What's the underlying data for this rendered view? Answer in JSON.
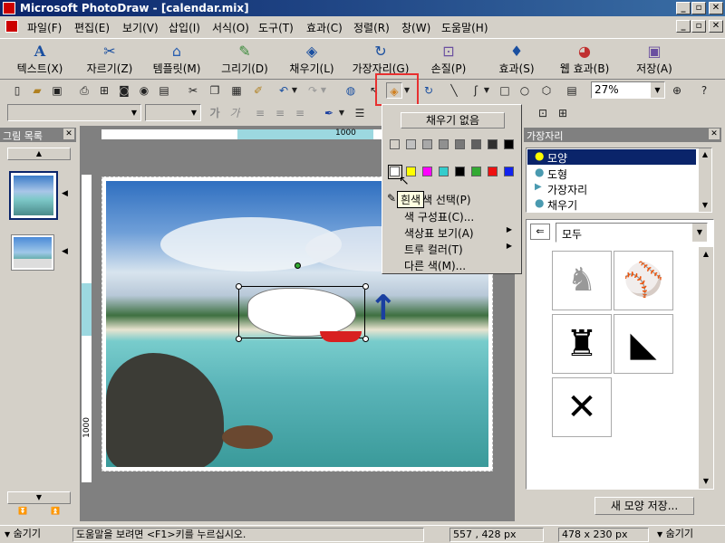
{
  "window": {
    "title": "Microsoft PhotoDraw - [calendar.mix]"
  },
  "menu": [
    "파일(F)",
    "편집(E)",
    "보기(V)",
    "삽입(I)",
    "서식(O)",
    "도구(T)",
    "효과(C)",
    "정렬(R)",
    "창(W)",
    "도움말(H)"
  ],
  "big_toolbar": {
    "text": "텍스트(X)",
    "cut": "자르기(Z)",
    "template": "템플릿(M)",
    "draw": "그리기(D)",
    "fill": "채우기(L)",
    "edge": "가장자리(G)",
    "touchup": "손질(P)",
    "effects": "효과(S)",
    "web_effects": "웹 효과(B)",
    "save": "저장(A)"
  },
  "std_toolbar": {
    "zoom": "27%",
    "help": "?"
  },
  "format_toolbar": {
    "bold": "가",
    "italic": "가"
  },
  "left_panel": {
    "title": "그림 목록"
  },
  "ruler": {
    "top_mark": "1000",
    "left_mark": "1000"
  },
  "fill_dropdown": {
    "no_fill": "채우기 없음",
    "tooltip": "흰색",
    "row1": [
      "#d4d0c8",
      "#c0c0c0",
      "#a8a8a8",
      "#909090",
      "#787878",
      "#606060",
      "#303030",
      "#000000"
    ],
    "row2": [
      "#ffffff",
      "#ffff00",
      "#ff00ff",
      "#33cccc",
      "#000000",
      "#33aa33",
      "#ee1111",
      "#1122ee"
    ],
    "items": [
      "색 선택(P)",
      "색 구성표(C)...",
      "색상표 보기(A)",
      "트루 컬러(T)",
      "다른 색(M)..."
    ]
  },
  "right_panel": {
    "title": "가장자리",
    "list": [
      "모양",
      "도형",
      "가장자리",
      "채우기"
    ],
    "category": "모두",
    "save_button": "새 모양 저장..."
  },
  "status": {
    "toggle_left": "숨기기",
    "help": "도움말을 보려면 <F1>키를 누르십시오.",
    "position": "557 , 428  px",
    "size": "478 x 230  px",
    "toggle_right": "숨기기"
  }
}
